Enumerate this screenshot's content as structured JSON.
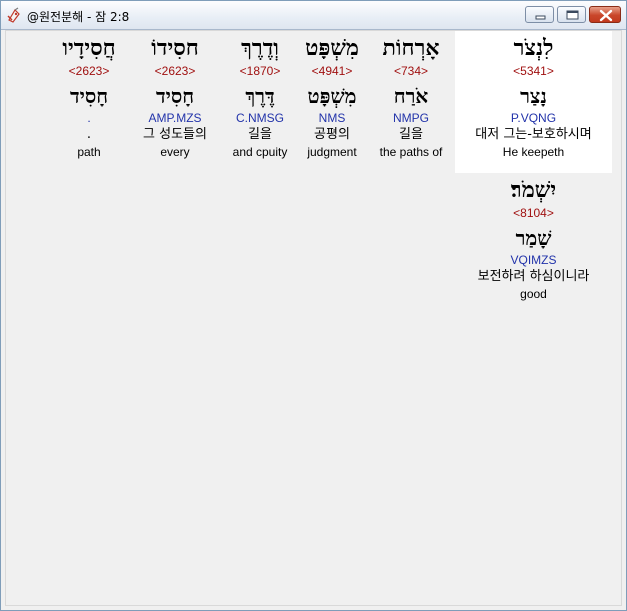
{
  "window": {
    "title": "@원전분해 - 잠 2:8"
  },
  "colors": {
    "strong": "#a01010",
    "morph": "#2233aa",
    "highlight": "#ffffff",
    "background": "#f0f0f0"
  },
  "words": [
    {
      "hebrew": "חֲסִידָיו",
      "strong": "<2623>",
      "lemma": "חָסִיד",
      "morph": ".",
      "korean": ".",
      "english": "path"
    },
    {
      "hebrew": "חסִידוֹ",
      "strong": "<2623>",
      "lemma": "חָסִיד",
      "morph": "AMP.MZS",
      "korean": "그 성도들의",
      "english": "every"
    },
    {
      "hebrew": "וְדֶרֶךְ",
      "strong": "<1870>",
      "lemma": "דֶּרֶךְ",
      "morph": "C.NMSG",
      "korean": "길을",
      "english": "and cpuity"
    },
    {
      "hebrew": "מִשְׁפָּט",
      "strong": "<4941>",
      "lemma": "מִשְׁפָּט",
      "morph": "NMS",
      "korean": "공평의",
      "english": "judgment"
    },
    {
      "hebrew": "אָרְחוֹת",
      "strong": "<734>",
      "lemma": "אֹרַח",
      "morph": "NMPG",
      "korean": "길을",
      "english": "the paths of"
    },
    {
      "hebrew": "לִנְצֹר",
      "strong": "<5341>",
      "lemma": "נָצַר",
      "morph": "P.VQNG",
      "korean": "대저 그는-보호하시며",
      "english": "He keepeth"
    },
    {
      "hebrew": "יִשְׁמֹר׃",
      "strong": "<8104>",
      "lemma": "שָׁמַר",
      "morph": "VQIMZS",
      "korean": "보전하려 하심이니라",
      "english": "good"
    }
  ]
}
